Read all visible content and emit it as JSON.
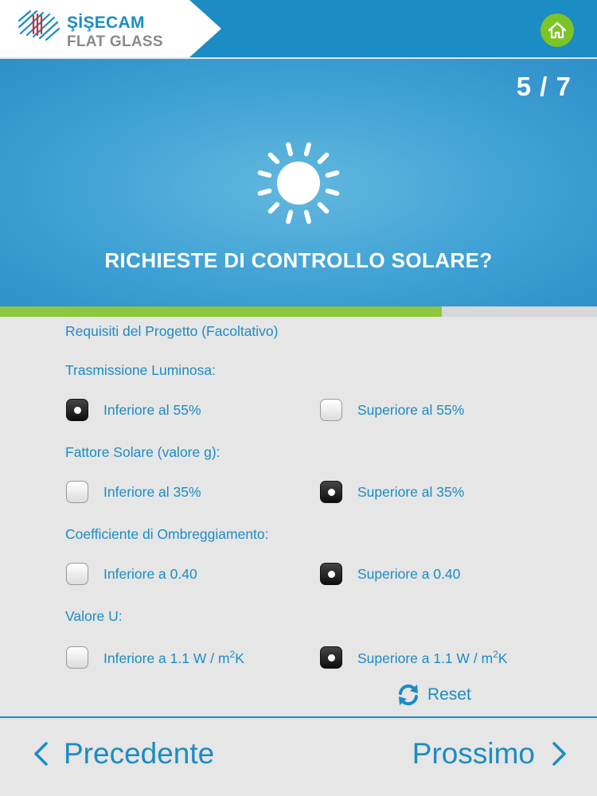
{
  "header": {
    "brand_name": "ŞİŞECAM",
    "brand_sub": "FLAT GLASS",
    "home_icon": "home-icon"
  },
  "hero": {
    "step": "5 / 7",
    "title": "RICHIESTE DI CONTROLLO SOLARE?",
    "progress_fraction": 0.74,
    "icon": "sun-icon"
  },
  "form": {
    "heading": "Requisiti del Progetto (Facoltativo)",
    "groups": [
      {
        "label": "Trasmissione Luminosa:",
        "options": [
          {
            "label": "Inferiore al 55%",
            "selected": true
          },
          {
            "label": "Superiore al 55%",
            "selected": false
          }
        ]
      },
      {
        "label": "Fattore Solare (valore g):",
        "options": [
          {
            "label": "Inferiore al 35%",
            "selected": false
          },
          {
            "label": "Superiore al 35%",
            "selected": true
          }
        ]
      },
      {
        "label": "Coefficiente di Ombreggiamento:",
        "options": [
          {
            "label": "Inferiore a 0.40",
            "selected": false
          },
          {
            "label": "Superiore a 0.40",
            "selected": true
          }
        ]
      },
      {
        "label": "Valore U:",
        "options": [
          {
            "label": "Inferiore a 1.1 W / m",
            "sup": "2",
            "suffix": "K",
            "selected": false
          },
          {
            "label": "Superiore a 1.1 W / m",
            "sup": "2",
            "suffix": "K",
            "selected": true
          }
        ]
      }
    ],
    "reset_label": "Reset"
  },
  "nav": {
    "prev_label": "Precedente",
    "next_label": "Prossimo"
  },
  "colors": {
    "primary": "#1b8cc4",
    "accent_green": "#8dc63f",
    "home_green": "#7ec427"
  }
}
